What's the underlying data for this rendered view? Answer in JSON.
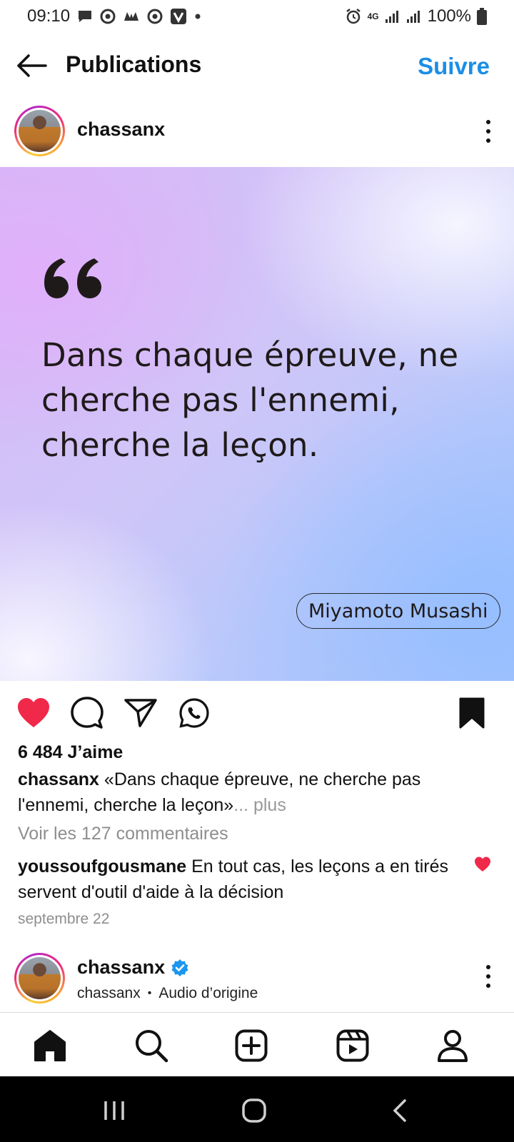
{
  "status_bar": {
    "time": "09:10",
    "battery": "100%",
    "network": "4G"
  },
  "header": {
    "title": "Publications",
    "follow_label": "Suivre"
  },
  "post": {
    "username": "chassanx",
    "quote": "Dans chaque épreuve, ne cherche pas l'ennemi, cherche la leçon.",
    "author": "Miyamoto Musashi",
    "liked": true,
    "saved": true,
    "likes_text": "6 484 J’aime",
    "caption_user": "chassanx",
    "caption_text": " «Dans chaque épreuve, ne cherche pas l'ennemi, cherche la leçon»",
    "caption_more": "... plus",
    "view_comments": "Voir les 127 commentaires",
    "comment_user": "youssoufgousmane",
    "comment_text": " En tout cas, les leçons a en tirés servent d'outil d'aide à la décision",
    "date": "septembre 22"
  },
  "next_post": {
    "username": "chassanx",
    "sub_user": "chassanx",
    "audio": "Audio d’origine",
    "verified": true
  },
  "colors": {
    "accent": "#1a8ee6",
    "like": "#f02849",
    "verified": "#1c96f0"
  },
  "icons": {
    "back": "arrow-left",
    "like": "heart-filled",
    "comment": "speech-bubble",
    "share": "paper-plane",
    "whatsapp": "whatsapp",
    "save": "bookmark-filled",
    "more": "three-dots-vertical",
    "nav": [
      "home",
      "search",
      "create",
      "reels",
      "profile"
    ]
  }
}
